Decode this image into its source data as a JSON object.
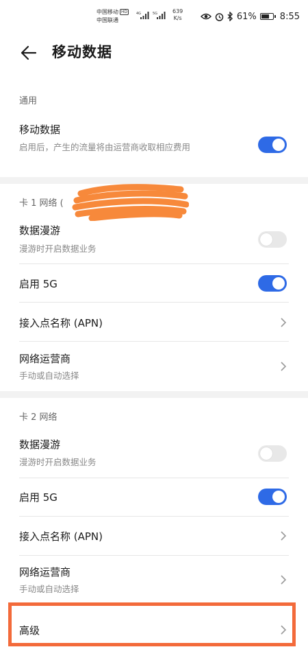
{
  "status_bar": {
    "carrier1": "中国移动",
    "carrier1_badge": "HD",
    "carrier2": "中国联通",
    "net1": "4G",
    "net2": "5G",
    "speed_value": "639",
    "speed_unit": "K/s",
    "battery": "61%",
    "time": "8:55",
    "icons": [
      "eye-icon",
      "alarm-icon",
      "bluetooth-icon",
      "battery-icon"
    ]
  },
  "header": {
    "title": "移动数据",
    "back_icon": "arrow-left-icon"
  },
  "general": {
    "label": "通用",
    "mobile_data": {
      "title": "移动数据",
      "sub": "启用后，产生的流量将由运营商收取相应费用",
      "on": true
    }
  },
  "sim1": {
    "label": "卡 1 网络 (",
    "roaming": {
      "title": "数据漫游",
      "sub": "漫游时开启数据业务",
      "on": false
    },
    "five_g": {
      "title": "启用 5G",
      "on": true
    },
    "apn": {
      "title": "接入点名称 (APN)"
    },
    "operator": {
      "title": "网络运营商",
      "sub": "手动或自动选择"
    }
  },
  "sim2": {
    "label": "卡 2 网络",
    "roaming": {
      "title": "数据漫游",
      "sub": "漫游时开启数据业务",
      "on": false
    },
    "five_g": {
      "title": "启用 5G",
      "on": true
    },
    "apn": {
      "title": "接入点名称 (APN)"
    },
    "operator": {
      "title": "网络运营商",
      "sub": "手动或自动选择"
    }
  },
  "advanced": {
    "title": "高级"
  },
  "colors": {
    "accent": "#2e6ae6",
    "highlight": "#f36a3a",
    "redaction": "#f7893b"
  }
}
